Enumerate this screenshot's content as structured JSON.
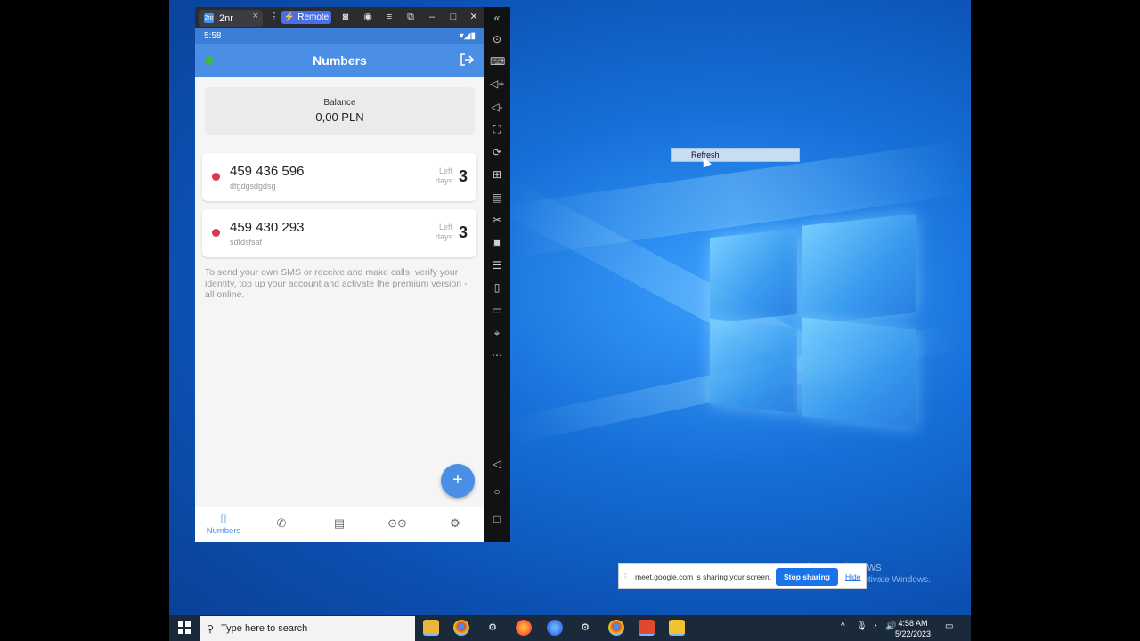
{
  "emulator": {
    "tab_title": "2nr",
    "tab_logo": "2nr",
    "tab_close": "×",
    "remote_label": "Remote"
  },
  "phone": {
    "status_time": "5:58",
    "app_title": "Numbers",
    "balance_label": "Balance",
    "balance_value": "0,00 PLN",
    "numbers": [
      {
        "number": "459 436 596",
        "note": "dfgdgsdgdsg",
        "left_label_1": "Left",
        "left_label_2": "days",
        "days": "3"
      },
      {
        "number": "459 430 293",
        "note": "sdfdsfsaf",
        "left_label_1": "Left",
        "left_label_2": "days",
        "days": "3"
      }
    ],
    "info_text": "To send your own SMS or receive and make calls, verify your identity, top up your account and activate the premium version - all online.",
    "fab_label": "+",
    "nav": {
      "numbers_label": "Numbers"
    }
  },
  "desktop": {
    "context_menu_item": "Refresh",
    "share_message": "meet.google.com is sharing your screen.",
    "stop_sharing": "Stop sharing",
    "hide": "Hide",
    "activate_title": "Activate Windows",
    "activate_sub": "Go to Settings to activate Windows."
  },
  "taskbar": {
    "search_placeholder": "Type here to search",
    "time": "4:58 AM",
    "date": "5/22/2023"
  },
  "colors": {
    "app_bar": "#4a8ee6",
    "status_dot_online": "#3cb84a",
    "number_dot": "#d6394a",
    "stop_sharing_bg": "#1a73e8"
  }
}
